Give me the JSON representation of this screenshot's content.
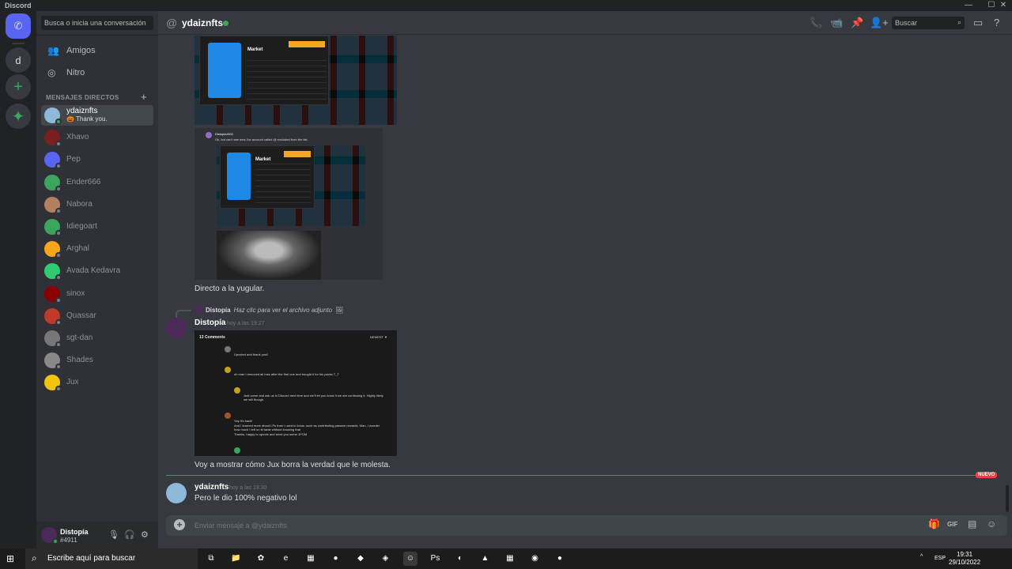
{
  "titlebar": {
    "app": "Discord",
    "min": "—",
    "max": "☐",
    "close": "✕"
  },
  "guilds": {
    "home_glyph": "✆",
    "user_guild": "d",
    "add_glyph": "+",
    "explore_glyph": "✦"
  },
  "dm": {
    "search_placeholder": "Busca o inicia una conversación",
    "nav": [
      {
        "label": "Amigos",
        "icon": "friends-icon",
        "glyph": "👥"
      },
      {
        "label": "Nitro",
        "icon": "nitro-icon",
        "glyph": "◎"
      }
    ],
    "header": "MENSAJES DIRECTOS",
    "add_glyph": "+",
    "items": [
      {
        "name": "ydaiznfts",
        "sub": "🎃 Thank you.",
        "color": "#8fb9d9",
        "online": true
      },
      {
        "name": "Xhavo",
        "sub": "",
        "color": "#7a1f1f",
        "online": false
      },
      {
        "name": "Pep",
        "sub": "",
        "color": "#5865f2",
        "online": false
      },
      {
        "name": "Ender666",
        "sub": "",
        "color": "#3ba55d",
        "online": false
      },
      {
        "name": "Nabora",
        "sub": "",
        "color": "#b08060",
        "online": false
      },
      {
        "name": "Idiegoart",
        "sub": "",
        "color": "#3ba55d",
        "online": false
      },
      {
        "name": "Arghal",
        "sub": "",
        "color": "#faa61a",
        "online": false
      },
      {
        "name": "Avada Kedavra",
        "sub": "",
        "color": "#2ecc71",
        "online": false
      },
      {
        "name": "sinox",
        "sub": "",
        "color": "#8b0000",
        "online": false
      },
      {
        "name": "Quassar",
        "sub": "",
        "color": "#c0392b",
        "online": false
      },
      {
        "name": "sgt-dan",
        "sub": "",
        "color": "#777777",
        "online": false
      },
      {
        "name": "Shades",
        "sub": "",
        "color": "#888888",
        "online": false
      },
      {
        "name": "Jux",
        "sub": "",
        "color": "#f1c40f",
        "online": false
      }
    ]
  },
  "user": {
    "name": "Distopía",
    "tag": "#4911",
    "mic": "🎙",
    "headset": "🎧",
    "settings": "⚙"
  },
  "chat": {
    "at": "@",
    "title": "ydaiznfts",
    "header_icons": {
      "call": "📞",
      "video": "📹",
      "pin": "📌",
      "add_member": "👤+",
      "inbox": "▭",
      "help": "?"
    },
    "search_placeholder": "Buscar",
    "search_glyph": "⌕",
    "market_label": "Market",
    "embed_author": "Distopia4911",
    "embed_text": "Ok, but can't see new Jux account called @ excluded from the list.",
    "caption1": "Directo a la yugular.",
    "reply": {
      "author": "Distopía",
      "text": "Haz clic para ver el archivo adjunto",
      "icon": "🖼"
    },
    "msg2": {
      "author": "Distopía",
      "time": "hoy a las 19:27",
      "text": "Voy a mostrar cómo Jux borra la verdad que le molesta."
    },
    "comments": {
      "title": "13 Comments",
      "sort": "NEWEST ▼",
      "lines": [
        "Upvoted and thank you!!",
        "oh man i removed all mes after the first one and bought it for his packs T_T",
        "Just come and ask us in Discord next time and we'll let you know if we are continuing it. Highly likely we will though.",
        "Yay it's back!",
        "And I learned more about LPs than I used to know, such as contributing passive rewards. Man, I wonder how much I left on th table without knowing that",
        "Thanks, happy to upvote and send you some 1POM"
      ]
    },
    "new_label": "NUEVO",
    "msg3": {
      "author": "ydaiznfts",
      "time": "hoy a las 19:30",
      "text": "Pero le dio 100% negativo lol"
    },
    "composer": {
      "plus": "+",
      "placeholder": "Enviar mensaje a @ydaiznfts",
      "gift": "🎁",
      "gif": "GIF",
      "sticker": "▤",
      "emoji": "☺"
    }
  },
  "taskbar": {
    "start": "⊞",
    "search_glyph": "⌕",
    "search_text": "Escribe aquí para buscar",
    "tray_lang": "ESP",
    "tray_caret": "^",
    "time": "19:31",
    "date": "29/10/2022",
    "apps": [
      {
        "name": "task-view-icon",
        "glyph": "⧉"
      },
      {
        "name": "file-explorer-icon",
        "glyph": "📁"
      },
      {
        "name": "app-icon",
        "glyph": "✿"
      },
      {
        "name": "edge-icon",
        "glyph": "e"
      },
      {
        "name": "store-icon",
        "glyph": "▦"
      },
      {
        "name": "chrome-icon",
        "glyph": "●"
      },
      {
        "name": "app-red-icon",
        "glyph": "◆"
      },
      {
        "name": "app-blue-icon",
        "glyph": "◈"
      },
      {
        "name": "discord-icon",
        "glyph": "☺"
      },
      {
        "name": "photoshop-icon",
        "glyph": "Ps"
      },
      {
        "name": "app-circle-icon",
        "glyph": "◐"
      },
      {
        "name": "vlc-icon",
        "glyph": "▲"
      },
      {
        "name": "calculator-icon",
        "glyph": "▦"
      },
      {
        "name": "media-icon",
        "glyph": "◉"
      },
      {
        "name": "chrome2-icon",
        "glyph": "●"
      }
    ]
  }
}
